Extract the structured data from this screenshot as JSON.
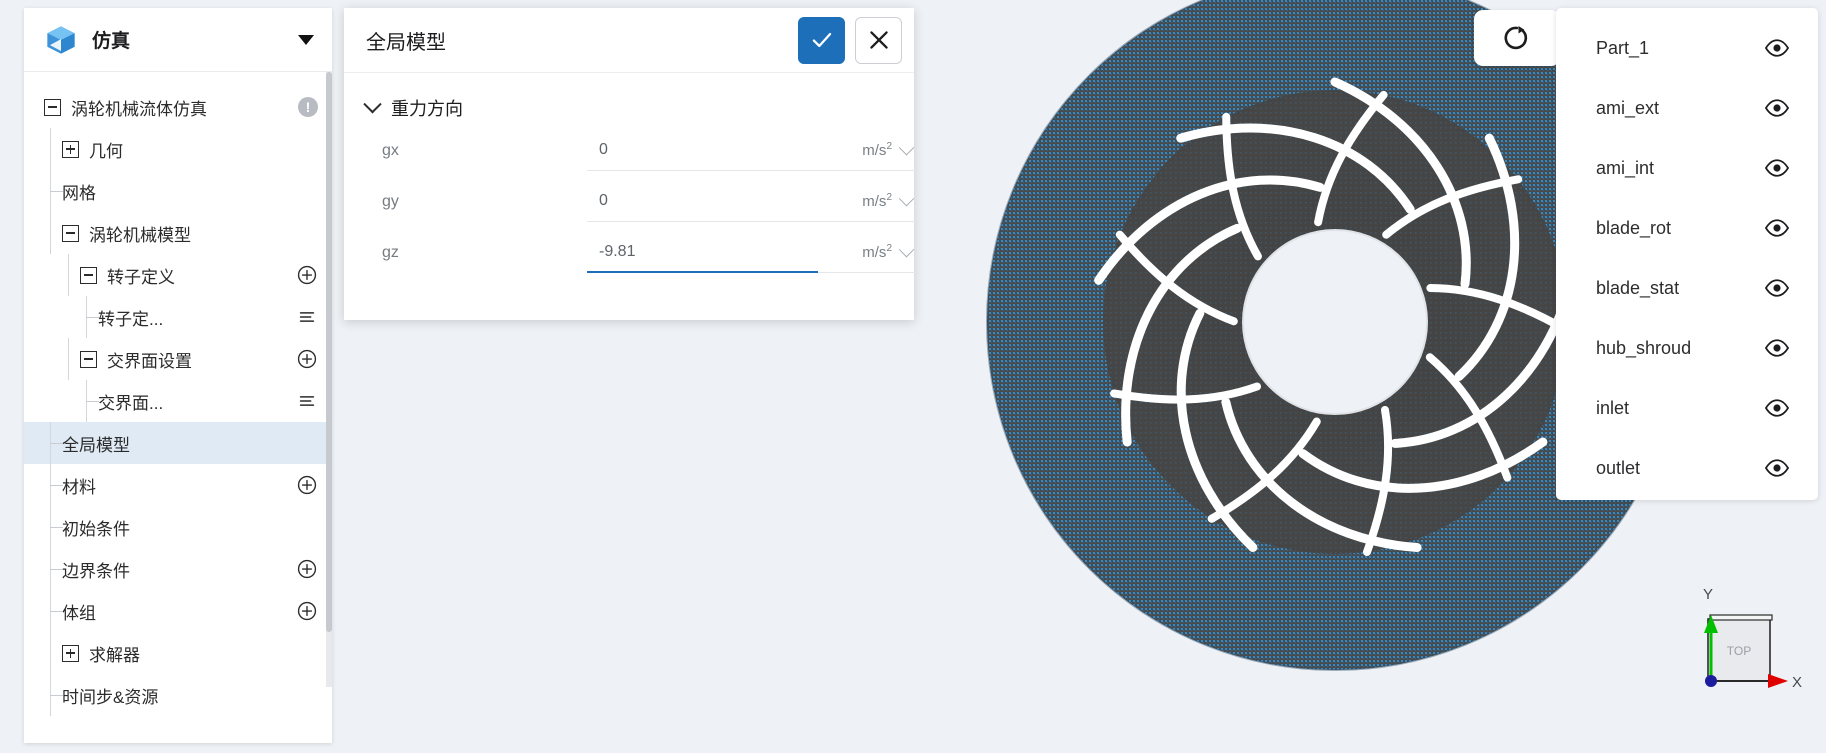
{
  "app": {
    "sidebar_title": "仿真",
    "logo_icon": "cube-icon",
    "collapse_icon": "caret-down-icon"
  },
  "tree": {
    "items": [
      {
        "label": "涡轮机械流体仿真",
        "depth": 0,
        "toggle": "minus",
        "badge": "!",
        "action": ""
      },
      {
        "label": "几何",
        "depth": 1,
        "toggle": "plus",
        "badge": "",
        "action": ""
      },
      {
        "label": "网格",
        "depth": 1,
        "toggle": "leaf",
        "badge": "",
        "action": ""
      },
      {
        "label": "涡轮机械模型",
        "depth": 1,
        "toggle": "minus",
        "badge": "",
        "action": ""
      },
      {
        "label": "转子定义",
        "depth": 2,
        "toggle": "minus",
        "badge": "",
        "action": "plus-circle-icon"
      },
      {
        "label": "转子定...",
        "depth": 3,
        "toggle": "leaf",
        "badge": "",
        "action": "list-icon"
      },
      {
        "label": "交界面设置",
        "depth": 2,
        "toggle": "minus",
        "badge": "",
        "action": "plus-circle-icon"
      },
      {
        "label": "交界面...",
        "depth": 3,
        "toggle": "leaf",
        "badge": "",
        "action": "list-icon"
      },
      {
        "label": "全局模型",
        "depth": 1,
        "toggle": "leaf",
        "badge": "",
        "action": "",
        "selected": true
      },
      {
        "label": "材料",
        "depth": 1,
        "toggle": "leaf",
        "badge": "",
        "action": "plus-circle-icon"
      },
      {
        "label": "初始条件",
        "depth": 1,
        "toggle": "leaf",
        "badge": "",
        "action": ""
      },
      {
        "label": "边界条件",
        "depth": 1,
        "toggle": "leaf",
        "badge": "",
        "action": "plus-circle-icon"
      },
      {
        "label": "体组",
        "depth": 1,
        "toggle": "leaf",
        "badge": "",
        "action": "plus-circle-icon"
      },
      {
        "label": "求解器",
        "depth": 1,
        "toggle": "plus",
        "badge": "",
        "action": ""
      },
      {
        "label": "时间步&资源",
        "depth": 1,
        "toggle": "leaf",
        "badge": "",
        "action": ""
      }
    ]
  },
  "dialog": {
    "title": "全局模型",
    "confirm_icon": "check-icon",
    "cancel_icon": "close-icon",
    "section": {
      "title": "重力方向",
      "collapse_icon": "chevron-down-icon",
      "fields": [
        {
          "label": "gx",
          "value": "0",
          "unit": "m/s",
          "unit_sup": "2",
          "active": false
        },
        {
          "label": "gy",
          "value": "0",
          "unit": "m/s",
          "unit_sup": "2",
          "active": false
        },
        {
          "label": "gz",
          "value": "-9.81",
          "unit": "m/s",
          "unit_sup": "2",
          "active": true
        }
      ]
    }
  },
  "viewport": {
    "reset_button_icon": "reset-view-icon",
    "axis_widget": {
      "face_label": "TOP",
      "y_label": "Y",
      "x_label": "X",
      "y_color": "#00c000",
      "x_color": "#e00000",
      "origin_color": "#1c1c9e"
    },
    "model_colors": {
      "surface": "#4a4a4a",
      "mesh": "#2b8fd4",
      "background": "#eef1f5",
      "blade_gap": "#ffffff"
    }
  },
  "parts": {
    "items": [
      {
        "name": "Part_1",
        "visibility_icon": "eye-icon"
      },
      {
        "name": "ami_ext",
        "visibility_icon": "eye-icon"
      },
      {
        "name": "ami_int",
        "visibility_icon": "eye-icon"
      },
      {
        "name": "blade_rot",
        "visibility_icon": "eye-icon"
      },
      {
        "name": "blade_stat",
        "visibility_icon": "eye-icon"
      },
      {
        "name": "hub_shroud",
        "visibility_icon": "eye-icon"
      },
      {
        "name": "inlet",
        "visibility_icon": "eye-icon"
      },
      {
        "name": "outlet",
        "visibility_icon": "eye-icon"
      }
    ]
  },
  "colors": {
    "accent": "#1c6fb8",
    "selected_row": "#dfeaf4",
    "panel_bg": "#ffffff",
    "app_bg": "#eef1f5"
  }
}
